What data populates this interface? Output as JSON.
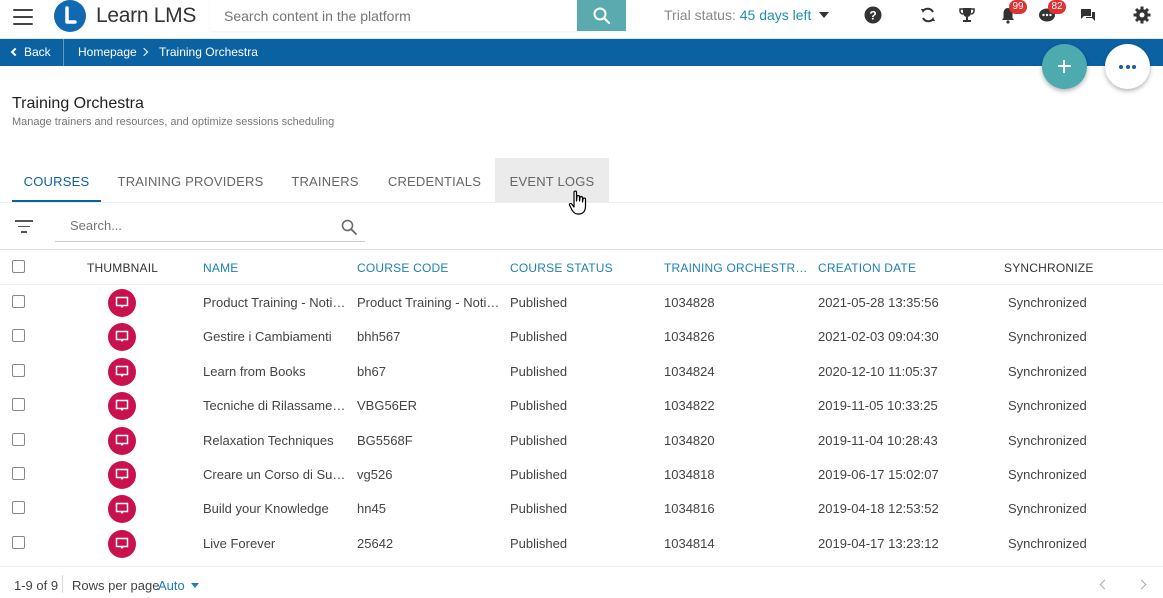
{
  "app": {
    "name": "Learn LMS"
  },
  "search": {
    "placeholder": "Search content in the platform"
  },
  "trial": {
    "label": "Trial status:",
    "days": "45 days left"
  },
  "badges": {
    "notifications": "99",
    "messages": "82"
  },
  "icons": [
    "menu-icon",
    "search-icon",
    "help-icon",
    "sync-icon",
    "trophy-icon",
    "bell-icon",
    "chat-icon",
    "forum-icon",
    "settings-icon"
  ],
  "breadcrumb": {
    "back": "Back",
    "home": "Homepage",
    "current": "Training Orchestra"
  },
  "page": {
    "title": "Training Orchestra",
    "subtitle": "Manage trainers and resources, and optimize sessions scheduling"
  },
  "tabs": [
    {
      "label": "COURSES",
      "active": true
    },
    {
      "label": "TRAINING PROVIDERS",
      "active": false
    },
    {
      "label": "TRAINERS",
      "active": false
    },
    {
      "label": "CREDENTIALS",
      "active": false
    },
    {
      "label": "EVENT LOGS",
      "active": false
    }
  ],
  "table_search": {
    "placeholder": "Search..."
  },
  "columns": {
    "thumbnail": "THUMBNAIL",
    "name": "NAME",
    "code": "COURSE CODE",
    "status": "COURSE STATUS",
    "to_id": "TRAINING ORCHESTRA ...",
    "date": "CREATION DATE",
    "sync": "SYNCHRONIZE"
  },
  "rows": [
    {
      "name": "Product Training - Notifi...",
      "code": "Product Training - Notifi...",
      "status": "Published",
      "to_id": "1034828",
      "date": "2021-05-28 13:35:56",
      "sync": "Synchronized"
    },
    {
      "name": "Gestire i Cambiamenti",
      "code": "bhh567",
      "status": "Published",
      "to_id": "1034826",
      "date": "2021-02-03 09:04:30",
      "sync": "Synchronized"
    },
    {
      "name": "Learn from Books",
      "code": "bh67",
      "status": "Published",
      "to_id": "1034824",
      "date": "2020-12-10 11:05:37",
      "sync": "Synchronized"
    },
    {
      "name": "Tecniche di Rilassamento",
      "code": "VBG56ER",
      "status": "Published",
      "to_id": "1034822",
      "date": "2019-11-05 10:33:25",
      "sync": "Synchronized"
    },
    {
      "name": "Relaxation Techniques",
      "code": "BG5568F",
      "status": "Published",
      "to_id": "1034820",
      "date": "2019-11-04 10:28:43",
      "sync": "Synchronized"
    },
    {
      "name": "Creare un Corso di Succ...",
      "code": "vg526",
      "status": "Published",
      "to_id": "1034818",
      "date": "2019-06-17 15:02:07",
      "sync": "Synchronized"
    },
    {
      "name": "Build your Knowledge",
      "code": "hn45",
      "status": "Published",
      "to_id": "1034816",
      "date": "2019-04-18 12:53:52",
      "sync": "Synchronized"
    },
    {
      "name": "Live Forever",
      "code": "25642",
      "status": "Published",
      "to_id": "1034814",
      "date": "2019-04-17 13:23:12",
      "sync": "Synchronized"
    }
  ],
  "footer": {
    "range": "1-9 of 9",
    "rows_label": "Rows per page",
    "rows_value": "Auto"
  },
  "colors": {
    "primary": "#0b62a3",
    "accent": "#4dabb0",
    "thumbnail": "#c9114e",
    "badge": "#dd3333"
  }
}
